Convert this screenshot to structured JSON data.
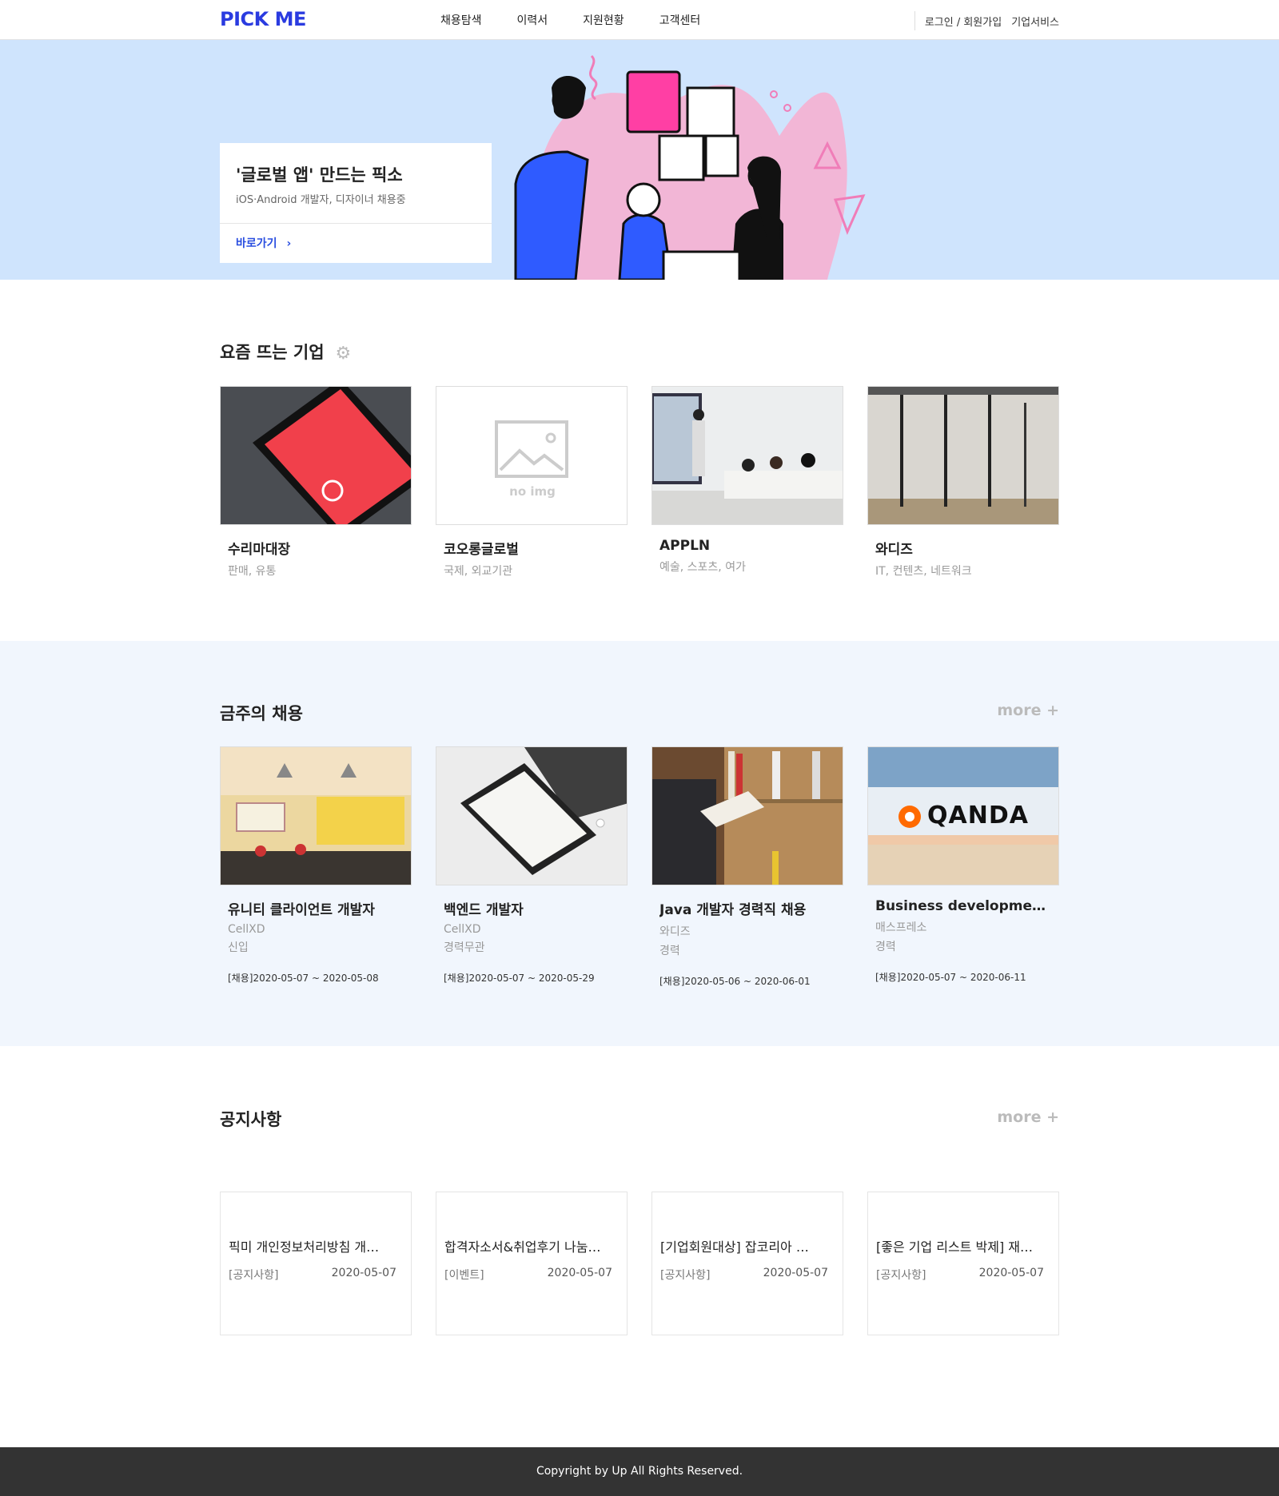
{
  "header": {
    "logo": "PICK ME",
    "nav": [
      "채용탐색",
      "이력서",
      "지원현황",
      "고객센터"
    ],
    "login": "로그인 / 회원가입",
    "company_service": "기업서비스"
  },
  "hero": {
    "title": "'글로벌 앱' 만드는 픽소",
    "subtitle": "iOS·Android 개발자, 디자이너 채용중",
    "link": "바로가기",
    "link_icon": "chevron-right-icon",
    "bg_color": "#cfe4fd"
  },
  "trending": {
    "title": "요즘 뜨는 기업",
    "title_icon": "gear-icon",
    "items": [
      {
        "name": "수리마대장",
        "category": "판매, 유통"
      },
      {
        "name": "코오롱글로벌",
        "category": "국제, 외교기관",
        "placeholder": "no img"
      },
      {
        "name": "APPLN",
        "category": "예술, 스포츠, 여가"
      },
      {
        "name": "와디즈",
        "category": "IT, 컨텐츠, 네트워크"
      }
    ]
  },
  "weekly": {
    "title": "금주의 채용",
    "more": "more +",
    "items": [
      {
        "title": "유니티 클라이언트 개발자",
        "company": "CellXD",
        "career": "신입",
        "period": "[채용]2020-05-07 ~ 2020-05-08"
      },
      {
        "title": "백엔드 개발자",
        "company": "CellXD",
        "career": "경력무관",
        "period": "[채용]2020-05-07 ~ 2020-05-29"
      },
      {
        "title": "Java 개발자 경력직 채용",
        "company": "와디즈",
        "career": "경력",
        "period": "[채용]2020-05-06 ~ 2020-06-01"
      },
      {
        "title": "Business development …",
        "company": "매스프레소",
        "career": "경력",
        "period": "[채용]2020-05-07 ~ 2020-06-11",
        "logo_text": "QANDA"
      }
    ]
  },
  "notices": {
    "title": "공지사항",
    "more": "more +",
    "items": [
      {
        "title": "픽미 개인정보처리방침 개…",
        "category": "[공지사항]",
        "date": "2020-05-07"
      },
      {
        "title": "합격자소서&취업후기 나눔…",
        "category": "[이벤트]",
        "date": "2020-05-07"
      },
      {
        "title": "[기업회원대상] 잡코리아 …",
        "category": "[공지사항]",
        "date": "2020-05-07"
      },
      {
        "title": "[좋은 기업 리스트 박제] 재…",
        "category": "[공지사항]",
        "date": "2020-05-07"
      }
    ]
  },
  "footer": {
    "copyright": "Copyright by Up All Rights Reserved."
  },
  "colors": {
    "brand": "#2a3be0",
    "hero_bg": "#cfe4fd",
    "recruit_bg": "#f1f6fd",
    "footer_bg": "#333333"
  }
}
